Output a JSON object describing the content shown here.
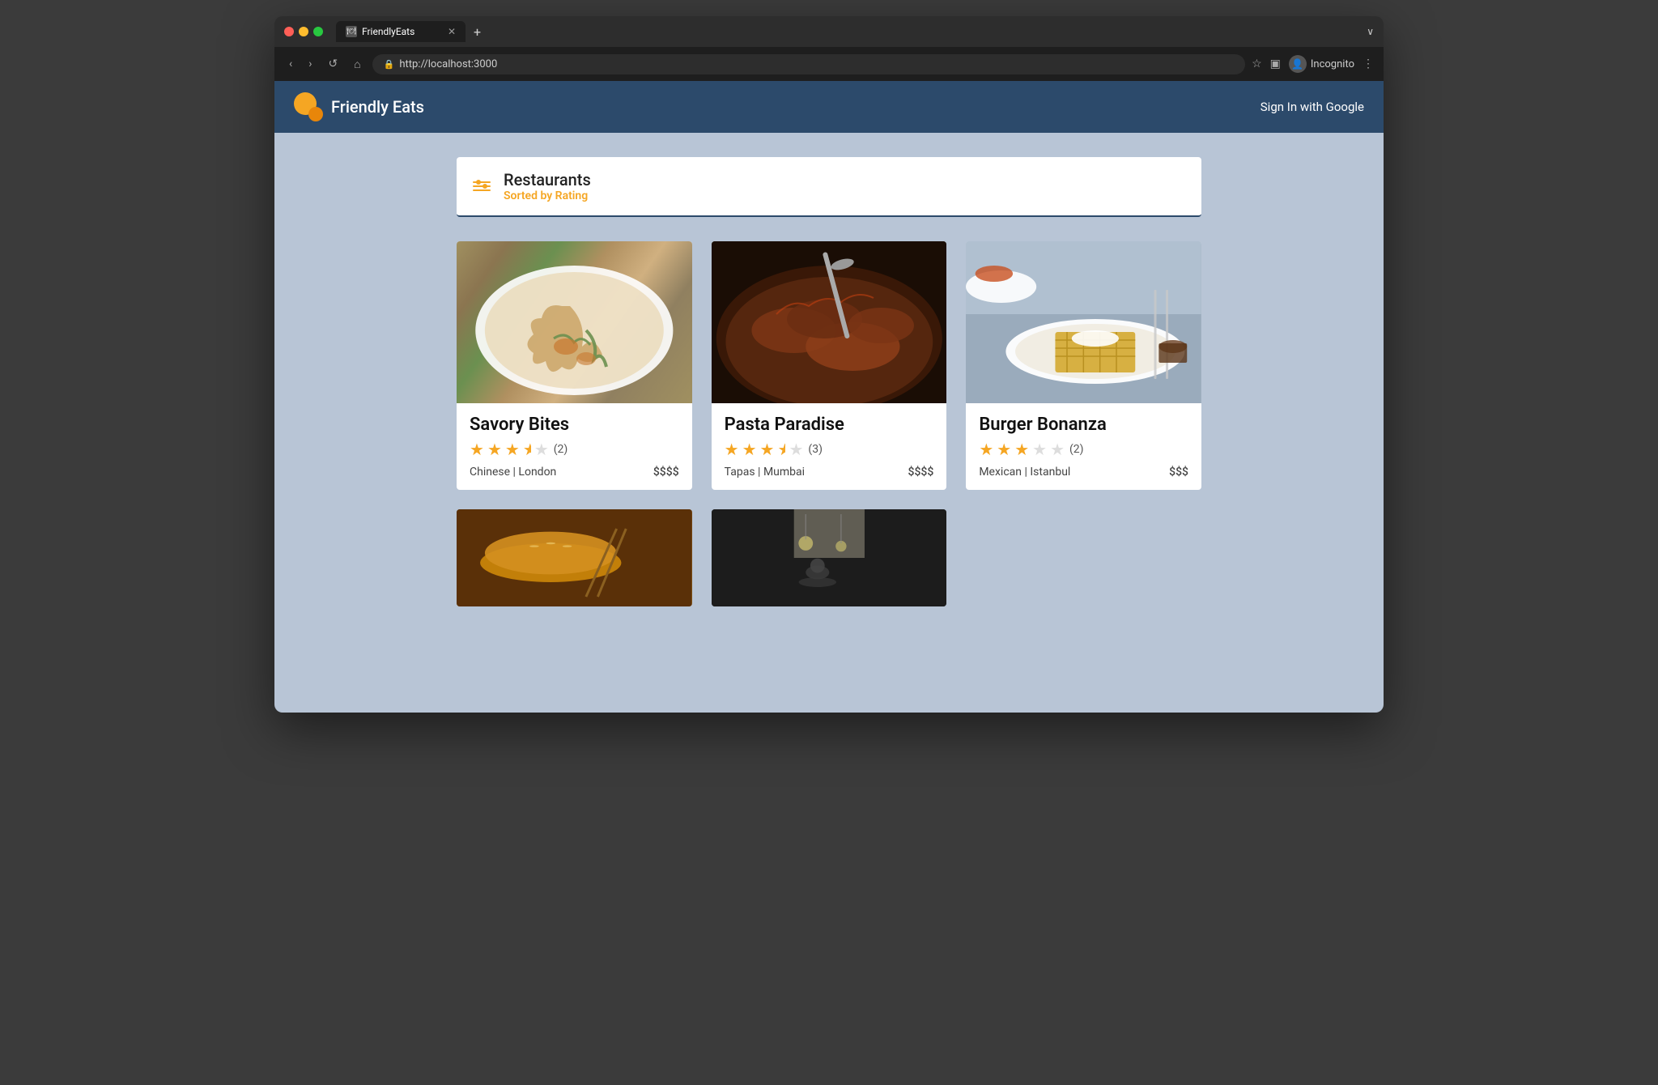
{
  "browser": {
    "url": "http://localhost:3000",
    "tab_label": "FriendlyEats",
    "tab_new_label": "+",
    "nav_back": "‹",
    "nav_forward": "›",
    "nav_reload": "↺",
    "nav_home": "⌂",
    "incognito_label": "Incognito",
    "bookmark_icon": "☆",
    "menu_icon": "⋮",
    "tab_end_icon": "∨"
  },
  "app": {
    "title": "Friendly Eats",
    "sign_in_label": "Sign In with Google",
    "logo_alt": "Friendly Eats Logo"
  },
  "section": {
    "title": "Restaurants",
    "subtitle": "Sorted by Rating"
  },
  "restaurants": [
    {
      "id": "savory-bites",
      "name": "Savory Bites",
      "rating": 3.5,
      "filled_stars": 3,
      "half_star": true,
      "empty_stars": 1,
      "review_count": "(2)",
      "cuisine": "Chinese",
      "location": "London",
      "price": "$$$$",
      "img_class": "img-savory-bites"
    },
    {
      "id": "pasta-paradise",
      "name": "Pasta Paradise",
      "rating": 3.5,
      "filled_stars": 3,
      "half_star": true,
      "empty_stars": 1,
      "review_count": "(3)",
      "cuisine": "Tapas",
      "location": "Mumbai",
      "price": "$$$$",
      "img_class": "img-pasta-paradise"
    },
    {
      "id": "burger-bonanza",
      "name": "Burger Bonanza",
      "rating": 3.0,
      "filled_stars": 3,
      "half_star": false,
      "empty_stars": 2,
      "review_count": "(2)",
      "cuisine": "Mexican",
      "location": "Istanbul",
      "price": "$$$",
      "img_class": "img-burger-bonanza"
    }
  ],
  "bottom_cards": [
    {
      "id": "bottom-left",
      "img_class": "img-bottom-left"
    },
    {
      "id": "bottom-right",
      "img_class": "img-bottom-right"
    }
  ]
}
